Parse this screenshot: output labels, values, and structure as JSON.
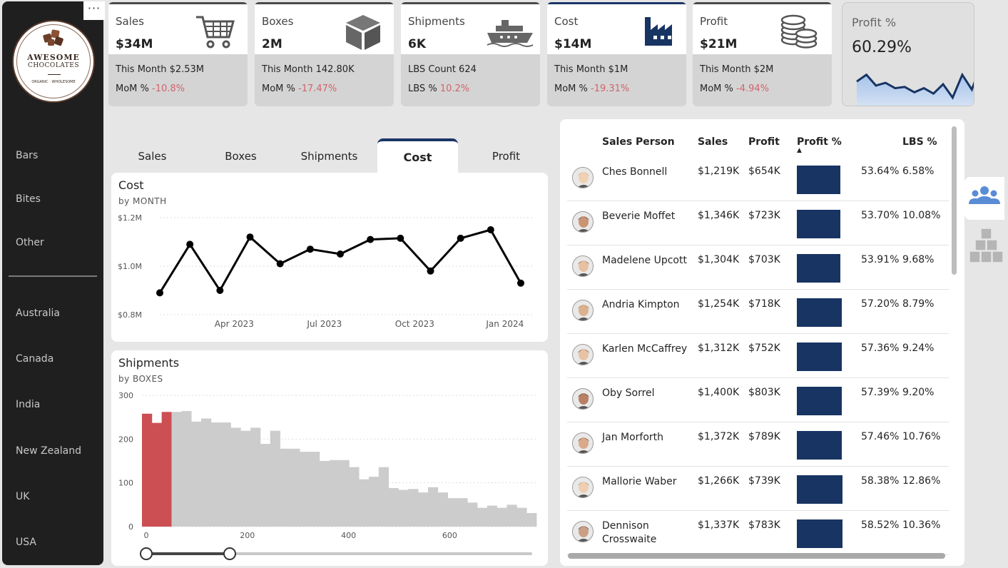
{
  "sidebar": {
    "more": "···",
    "logo": {
      "title": "AWESOME",
      "subtitle": "CHOCOLATES",
      "foot": "ORGANIC · WHOLESOME"
    },
    "product_items": [
      "Bars",
      "Bites",
      "Other"
    ],
    "country_items": [
      "Australia",
      "Canada",
      "India",
      "New Zealand",
      "UK",
      "USA"
    ]
  },
  "kpis": [
    {
      "label": "Sales",
      "value": "$34M",
      "line1": "This Month $2.53M",
      "line2_label": "MoM % ",
      "line2_value": "-10.8%",
      "icon": "shopping-cart-icon"
    },
    {
      "label": "Boxes",
      "value": "2M",
      "line1": "This Month 142.80K",
      "line2_label": "MoM % ",
      "line2_value": "-17.47%",
      "icon": "box-icon"
    },
    {
      "label": "Shipments",
      "value": "6K",
      "line1": "LBS Count 624",
      "line2_label": "LBS % ",
      "line2_value": "10.2%",
      "icon": "ship-icon"
    },
    {
      "label": "Cost",
      "value": "$14M",
      "line1": "This Month $1M",
      "line2_label": "MoM % ",
      "line2_value": "-19.31%",
      "icon": "factory-icon"
    },
    {
      "label": "Profit",
      "value": "$21M",
      "line1": "This Month $2M",
      "line2_label": "MoM % ",
      "line2_value": "-4.94%",
      "icon": "coins-icon"
    }
  ],
  "profit_card": {
    "label": "Profit %",
    "value": "60.29%",
    "trend": [
      55,
      60,
      52,
      54,
      50,
      51,
      47,
      50,
      46,
      53,
      43,
      60,
      49,
      68
    ]
  },
  "tabs": [
    "Sales",
    "Boxes",
    "Shipments",
    "Cost",
    "Profit"
  ],
  "active_tab": "Cost",
  "chart_data": [
    {
      "type": "line",
      "title": "Cost",
      "subtitle": "by MONTH",
      "x": [
        "2023-01",
        "2023-02",
        "2023-03",
        "2023-04",
        "2023-05",
        "2023-06",
        "2023-07",
        "2023-08",
        "2023-09",
        "2023-10",
        "2023-11",
        "2023-12",
        "2024-01",
        "2024-02"
      ],
      "x_ticks": [
        "Apr 2023",
        "Jul 2023",
        "Oct 2023",
        "Jan 2024"
      ],
      "values": [
        0.89,
        1.09,
        0.9,
        1.12,
        1.01,
        1.07,
        1.05,
        1.11,
        1.115,
        0.98,
        1.115,
        1.15,
        0.93
      ],
      "y_ticks": [
        "$1.2M",
        "$1.0M",
        "$0.8M"
      ],
      "ylim": [
        0.8,
        1.2
      ],
      "grid": true
    },
    {
      "type": "bar",
      "title": "Shipments",
      "subtitle": "by BOXES",
      "x_ticks": [
        "0",
        "200",
        "400",
        "600"
      ],
      "y_ticks": [
        "300",
        "200",
        "100",
        "0"
      ],
      "xlim": [
        0,
        780
      ],
      "ylim": [
        0,
        300
      ],
      "bin_width": 19.5,
      "highlight_color": "#cb4f53",
      "base_color": "#cccccc",
      "highlight_bins": 3,
      "values": [
        258,
        237,
        262,
        262,
        264,
        240,
        247,
        238,
        238,
        226,
        219,
        226,
        189,
        219,
        178,
        178,
        171,
        171,
        150,
        152,
        152,
        136,
        108,
        114,
        136,
        88,
        84,
        86,
        78,
        90,
        78,
        65,
        65,
        55,
        43,
        48,
        43,
        50,
        43,
        31
      ]
    }
  ],
  "slider": {
    "start": "0",
    "end": "160"
  },
  "table": {
    "headers": {
      "person": "Sales Person",
      "sales": "Sales",
      "profit": "Profit",
      "profit_pct": "Profit %",
      "lbs": "LBS %"
    },
    "sort_indicator": "▲",
    "rows": [
      {
        "name": "Ches Bonnell",
        "sales": "$1,219K",
        "profit": "$654K",
        "pct": "53.64%",
        "pct_value": 53.64,
        "lbs": "6.58%"
      },
      {
        "name": "Beverie Moffet",
        "sales": "$1,346K",
        "profit": "$723K",
        "pct": "53.70%",
        "pct_value": 53.7,
        "lbs": "10.08%"
      },
      {
        "name": "Madelene Upcott",
        "sales": "$1,304K",
        "profit": "$703K",
        "pct": "53.91%",
        "pct_value": 53.91,
        "lbs": "9.68%"
      },
      {
        "name": "Andria Kimpton",
        "sales": "$1,254K",
        "profit": "$718K",
        "pct": "57.20%",
        "pct_value": 57.2,
        "lbs": "8.79%"
      },
      {
        "name": "Karlen McCaffrey",
        "sales": "$1,312K",
        "profit": "$752K",
        "pct": "57.36%",
        "pct_value": 57.36,
        "lbs": "9.24%"
      },
      {
        "name": "Oby Sorrel",
        "sales": "$1,400K",
        "profit": "$803K",
        "pct": "57.39%",
        "pct_value": 57.39,
        "lbs": "9.20%"
      },
      {
        "name": "Jan Morforth",
        "sales": "$1,372K",
        "profit": "$789K",
        "pct": "57.46%",
        "pct_value": 57.46,
        "lbs": "10.76%"
      },
      {
        "name": "Mallorie Waber",
        "sales": "$1,266K",
        "profit": "$739K",
        "pct": "58.38%",
        "pct_value": 58.38,
        "lbs": "12.86%"
      },
      {
        "name": "Dennison\nCrosswaite",
        "sales": "$1,337K",
        "profit": "$783K",
        "pct": "58.52%",
        "pct_value": 58.52,
        "lbs": "10.36%"
      }
    ]
  },
  "side_buttons": [
    "people-icon",
    "boxes-stack-icon"
  ],
  "colors": {
    "sidebar": "#1f1f1f",
    "accent": "#1b3566",
    "negative": "#d0646b",
    "bar_highlight": "#cb4f53"
  }
}
